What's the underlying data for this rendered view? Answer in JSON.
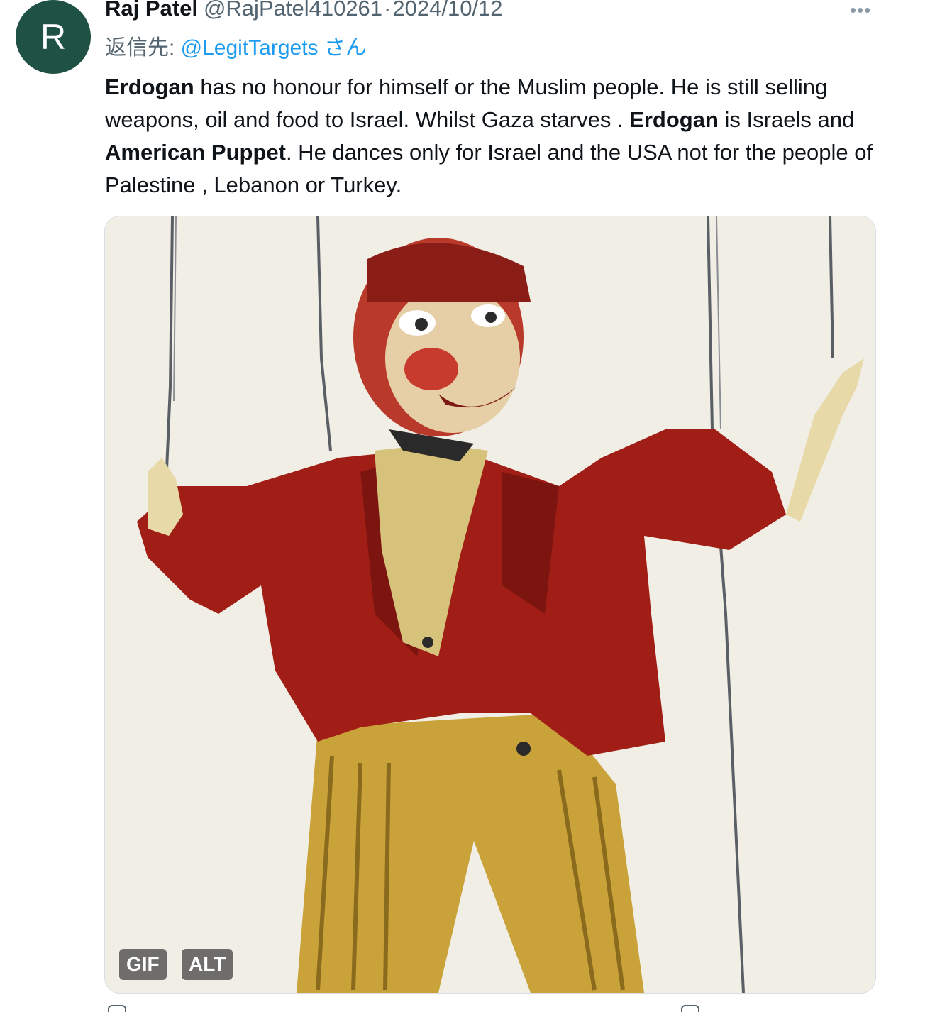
{
  "tweet": {
    "avatar_letter": "R",
    "avatar_color": "#1f5144",
    "display_name": "Raj Patel",
    "handle": "@RajPatel410261",
    "separator": "·",
    "date": "2024/10/12",
    "more_icon": "more-horizontal-icon",
    "reply_prefix": "返信先: ",
    "reply_mention": "@LegitTargets",
    "reply_suffix": " さん",
    "text_segments": [
      {
        "text": "Erdogan",
        "bold": true
      },
      {
        "text": " has no honour for himself or the Muslim people. He is still selling weapons, oil and food to Israel. Whilst Gaza starves . ",
        "bold": false
      },
      {
        "text": "Erdogan",
        "bold": true
      },
      {
        "text": " is Israels and ",
        "bold": false
      },
      {
        "text": "American Puppet",
        "bold": true
      },
      {
        "text": ". He dances only for Israel and the USA not for the people of Palestine , Lebanon or Turkey.",
        "bold": false
      }
    ],
    "media": {
      "type": "gif",
      "gif_badge": "GIF",
      "alt_badge": "ALT"
    }
  },
  "colors": {
    "text": "#0f1419",
    "secondary": "#536471",
    "link": "#1d9bf0"
  }
}
